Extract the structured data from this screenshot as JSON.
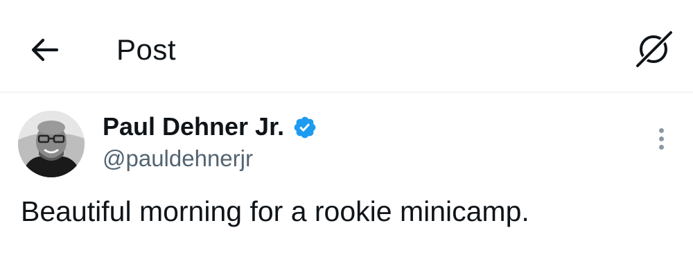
{
  "header": {
    "title": "Post",
    "back_icon": "arrow-left-icon",
    "grok_icon": "grok-icon"
  },
  "post": {
    "author": {
      "name": "Paul Dehner Jr.",
      "handle": "@pauldehnerjr",
      "verified": true,
      "verified_color": "#1d9bf0"
    },
    "text": "Beautiful morning for a rookie minicamp.",
    "more_icon": "more-vertical-icon"
  },
  "colors": {
    "text_primary": "#0f1419",
    "text_secondary": "#536471",
    "divider": "#eff3f4"
  }
}
